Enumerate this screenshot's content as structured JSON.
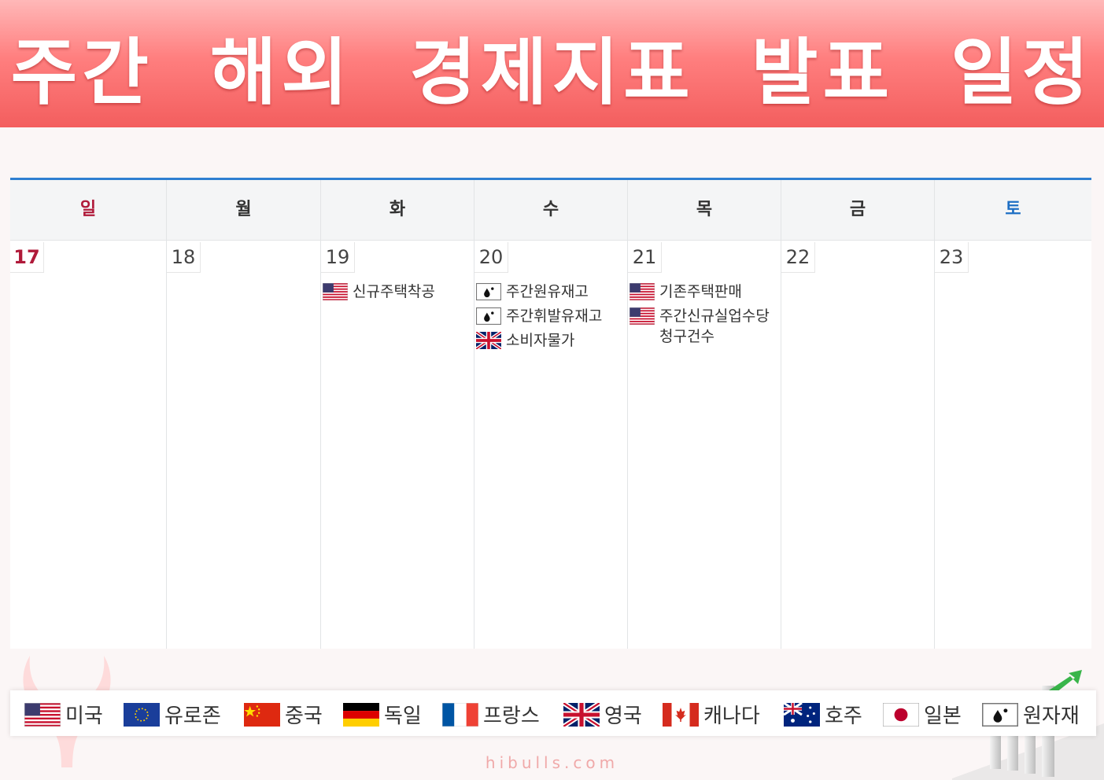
{
  "title": "주간 해외 경제지표 발표 일정",
  "colors": {
    "banner": "#f35e5e",
    "accent_line": "#2f7fd1",
    "sunday": "#b01a3a",
    "saturday": "#1e6fc4"
  },
  "weekdays": [
    "일",
    "월",
    "화",
    "수",
    "목",
    "금",
    "토"
  ],
  "days": [
    {
      "date": "17",
      "events": []
    },
    {
      "date": "18",
      "events": []
    },
    {
      "date": "19",
      "events": [
        {
          "flag": "us-flag-icon",
          "label": "신규주택착공"
        }
      ]
    },
    {
      "date": "20",
      "events": [
        {
          "flag": "commodity-icon",
          "label": "주간원유재고"
        },
        {
          "flag": "commodity-icon",
          "label": "주간휘발유재고"
        },
        {
          "flag": "uk-flag-icon",
          "label": "소비자물가"
        }
      ]
    },
    {
      "date": "21",
      "events": [
        {
          "flag": "us-flag-icon",
          "label": "기존주택판매"
        },
        {
          "flag": "us-flag-icon",
          "label": "주간신규실업수당청구건수"
        }
      ]
    },
    {
      "date": "22",
      "events": []
    },
    {
      "date": "23",
      "events": []
    }
  ],
  "legend": [
    {
      "flag": "us-flag-icon",
      "label": "미국"
    },
    {
      "flag": "eu-flag-icon",
      "label": "유로존"
    },
    {
      "flag": "china-flag-icon",
      "label": "중국"
    },
    {
      "flag": "germany-flag-icon",
      "label": "독일"
    },
    {
      "flag": "france-flag-icon",
      "label": "프랑스"
    },
    {
      "flag": "uk-flag-icon",
      "label": "영국"
    },
    {
      "flag": "canada-flag-icon",
      "label": "캐나다"
    },
    {
      "flag": "australia-flag-icon",
      "label": "호주"
    },
    {
      "flag": "japan-flag-icon",
      "label": "일본"
    },
    {
      "flag": "commodity-icon",
      "label": "원자재"
    }
  ],
  "watermark": "hibulls.com"
}
